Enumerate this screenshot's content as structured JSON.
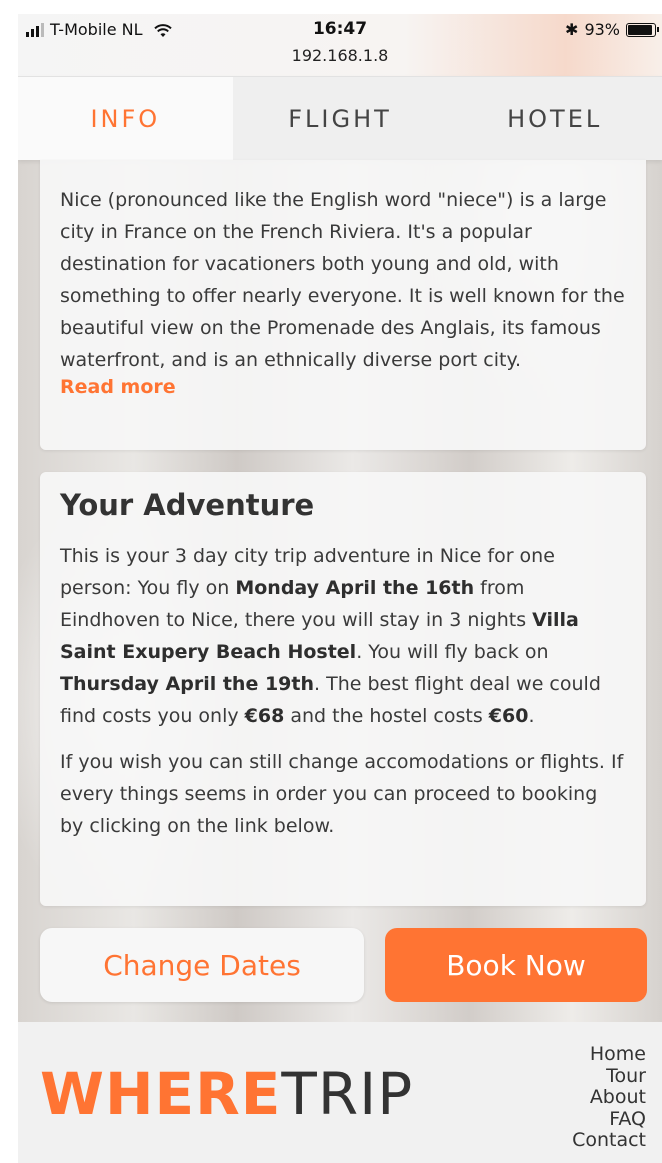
{
  "status_bar": {
    "carrier": "T-Mobile NL",
    "time": "16:47",
    "url": "192.168.1.8",
    "battery": "93%",
    "battery_level": 0.93,
    "icons": [
      "signal-icon",
      "wifi-icon",
      "bluetooth-icon",
      "battery-icon"
    ]
  },
  "tabs": [
    {
      "label": "INFO",
      "active": true
    },
    {
      "label": "FLIGHT",
      "active": false
    },
    {
      "label": "HOTEL",
      "active": false
    }
  ],
  "info_card": {
    "text": "Nice (pronounced like the English word \"niece\") is a large city in France on the French Riviera. It's a popular destination for vacationers both young and old, with something to offer nearly everyone. It is well known for the beautiful view on the Promenade des Anglais, its famous waterfront, and is an ethnically diverse port city.",
    "read_more": "Read more"
  },
  "adventure_card": {
    "title": "Your Adventure",
    "p1": {
      "t1": "This is your 3 day city trip adventure in Nice for one person: You fly on ",
      "b1": "Monday April the 16th",
      "t2": " from Eindhoven to Nice, there you will stay in 3 nights ",
      "b2": "Villa Saint Exupery Beach Hostel",
      "t3": ". You will fly back on ",
      "b3": "Thursday April the 19th",
      "t4": ". The best flight deal we could find costs you only ",
      "b4": "€68",
      "t5": " and the hostel costs ",
      "b5": "€60",
      "t6": "."
    },
    "p2": "If you wish you can still change accomodations or flights. If every things seems in order you can proceed to booking by clicking on the link below."
  },
  "buttons": {
    "change_dates": "Change Dates",
    "book_now": "Book Now"
  },
  "footer": {
    "logo_accent": "WHERE",
    "logo_rest": "TRIP",
    "nav": [
      "Home",
      "Tour",
      "About",
      "FAQ",
      "Contact"
    ]
  },
  "colors": {
    "accent": "#ff7433",
    "text": "#333333"
  }
}
